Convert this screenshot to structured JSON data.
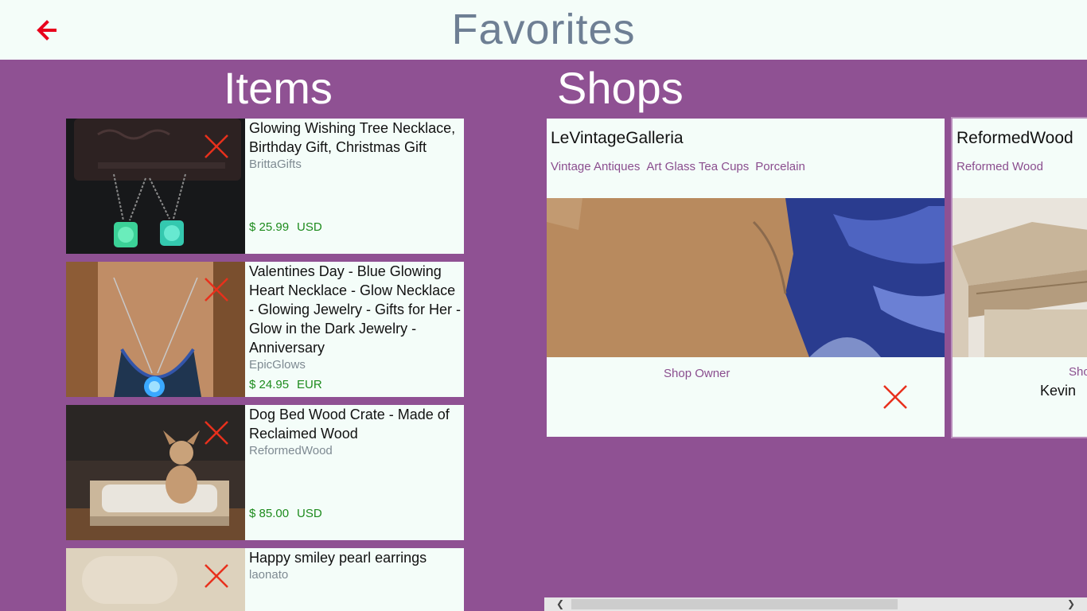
{
  "header": {
    "title": "Favorites",
    "back_icon": "arrow-left-icon",
    "accent": "#e8001c"
  },
  "sections": {
    "items_title": "Items",
    "shops_title": "Shops"
  },
  "items": [
    {
      "title": "Glowing Wishing Tree Necklace, Birthday Gift, Christmas Gift",
      "shop": "BrittaGifts",
      "price": "$ 25.99",
      "currency": "USD"
    },
    {
      "title": "Valentines Day - Blue Glowing Heart Necklace - Glow Necklace - Glowing Jewelry - Gifts for Her - Glow in the Dark Jewelry - Anniversary",
      "shop": "EpicGlows",
      "price": "$ 24.95",
      "currency": "EUR"
    },
    {
      "title": "Dog Bed Wood Crate  - Made of Reclaimed Wood",
      "shop": "ReformedWood",
      "price": "$ 85.00",
      "currency": "USD"
    },
    {
      "title": "Happy smiley pearl earrings",
      "shop": "laonato"
    }
  ],
  "shops": [
    {
      "name": "LeVintageGalleria",
      "tags": [
        "Vintage Antiques",
        "Art Glass Tea Cups",
        "Porcelain"
      ],
      "owner_label": "Shop Owner",
      "owner_name": ""
    },
    {
      "name": "ReformedWood",
      "tags": [
        "Reformed Wood"
      ],
      "owner_label": "Sho",
      "owner_name": "Kevin"
    }
  ],
  "colors": {
    "background": "#8f5193",
    "card": "#f4fdf9",
    "price": "#1d8b1d",
    "remove": "#e8301c",
    "link": "#8a4d8e"
  }
}
